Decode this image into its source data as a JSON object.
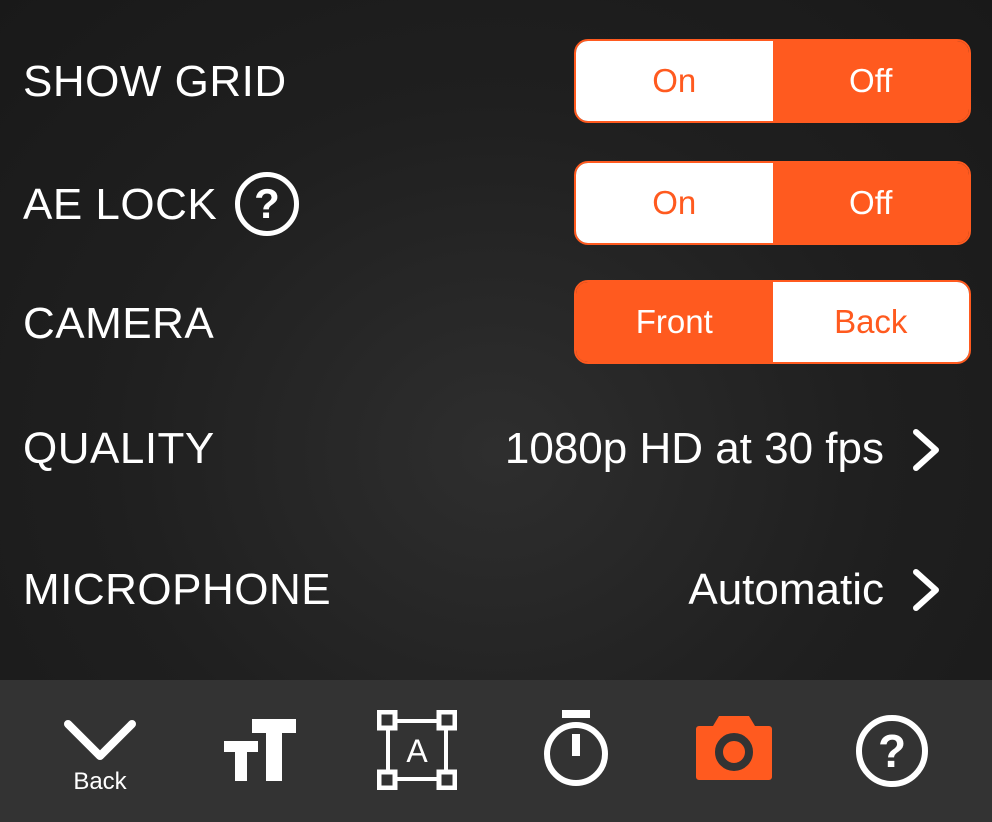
{
  "settings": {
    "show_grid": {
      "label": "SHOW GRID",
      "options": [
        "On",
        "Off"
      ],
      "selected": "Off"
    },
    "ae_lock": {
      "label": "AE LOCK",
      "help": "?",
      "options": [
        "On",
        "Off"
      ],
      "selected": "Off"
    },
    "camera": {
      "label": "CAMERA",
      "options": [
        "Front",
        "Back"
      ],
      "selected": "Front"
    },
    "quality": {
      "label": "QUALITY",
      "value": "1080p HD at 30 fps"
    },
    "microphone": {
      "label": "MICROPHONE",
      "value": "Automatic"
    }
  },
  "toolbar": {
    "back_label": "Back",
    "help": "?",
    "items": [
      "chevron-down-icon",
      "text-size-icon",
      "text-box-icon",
      "timer-icon",
      "camera-icon",
      "help-icon"
    ]
  },
  "colors": {
    "accent": "#ff5a1f",
    "background": "#1f1f1f",
    "toolbar": "#333333"
  }
}
